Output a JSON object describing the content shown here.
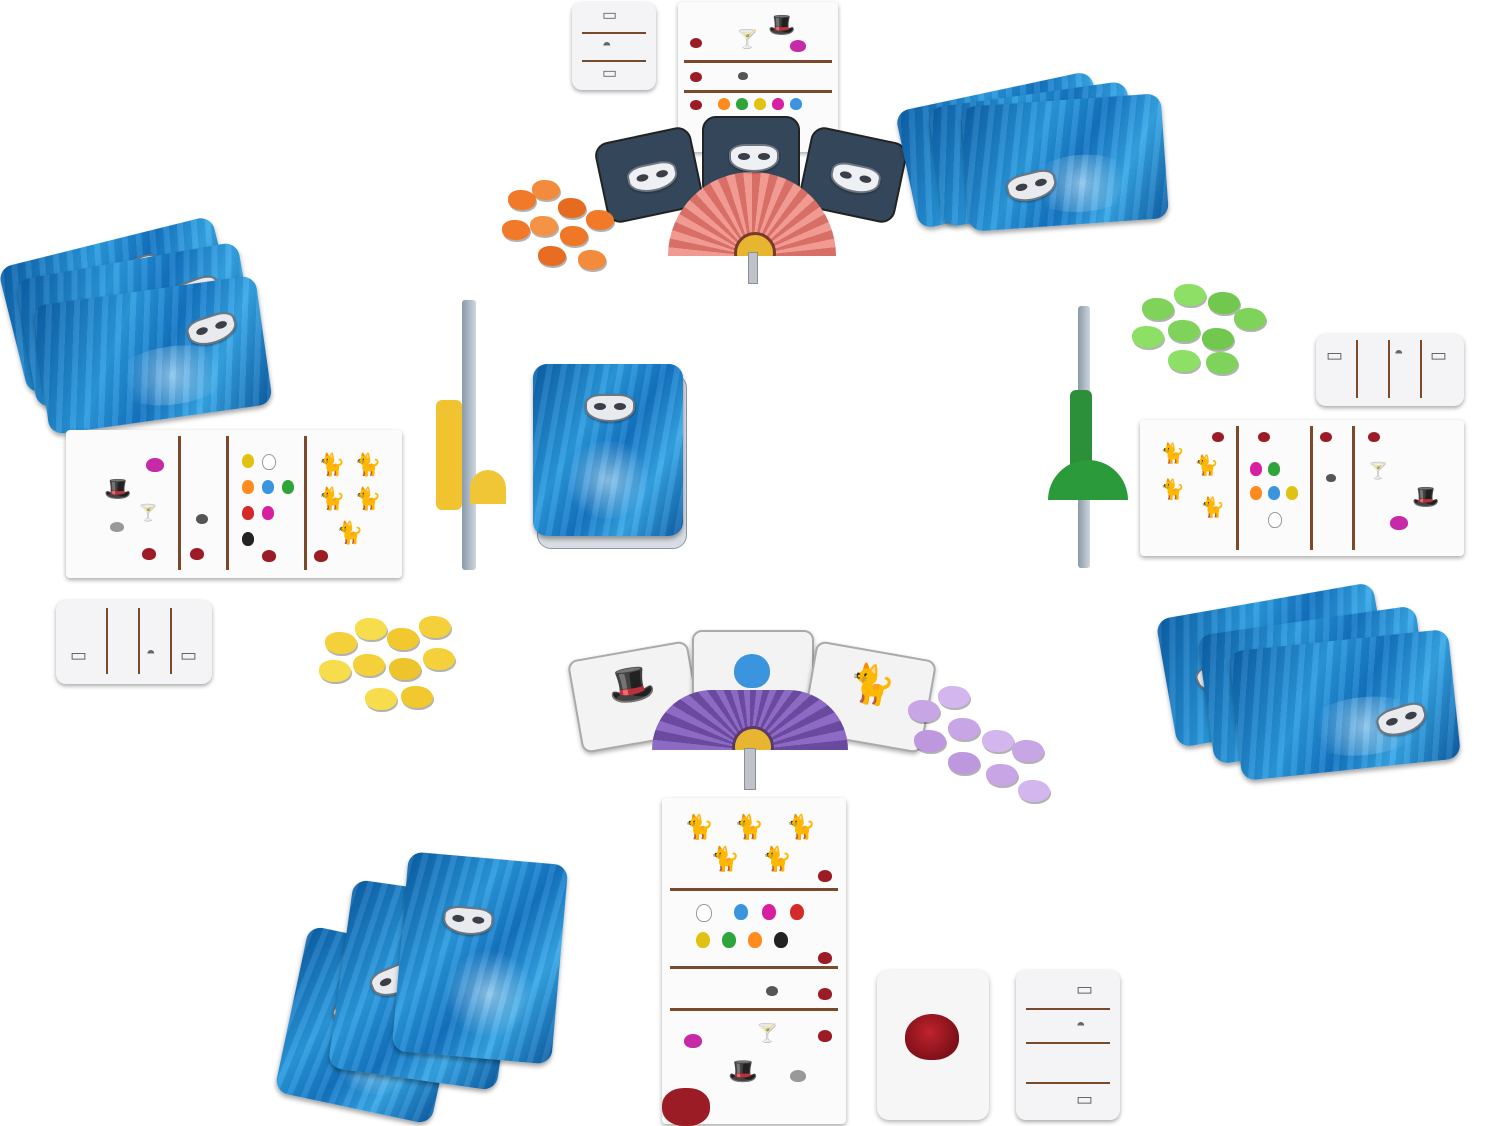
{
  "scene": {
    "type": "tabletop board game layout",
    "players": 4,
    "colors": {
      "card_back_blue": "#1a7ac8",
      "top_fan": "#e9837b",
      "bottom_fan": "#7b58b0",
      "token_orange": "#f07a2a",
      "token_yellow": "#f4d13a",
      "token_green": "#7fd35a",
      "token_purple": "#c8a6e6",
      "divider_brown": "#7a4a2d",
      "rose_red": "#9b1c24"
    },
    "icons": [
      "mask-icon",
      "top-hat-icon",
      "paw-icon",
      "cat-icon",
      "rose-icon",
      "martini-icon",
      "mouse-icon",
      "ball-of-yarn-icon"
    ],
    "face_up_cards_bottom": [
      "top-hat-icon",
      "paw-icon",
      "cat-icon"
    ],
    "draw_pile_count_label": "",
    "rose_card_icon": "rose-icon"
  }
}
